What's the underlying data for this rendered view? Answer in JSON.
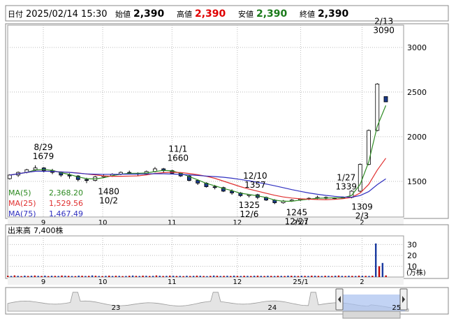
{
  "header": {
    "date_label": "日付",
    "date_value": "2025/02/14 15:30",
    "open_label": "始値",
    "open_value": "2,390",
    "high_label": "高値",
    "high_value": "2,390",
    "low_label": "安値",
    "low_value": "2,390",
    "close_label": "終値",
    "close_value": "2,390",
    "colors": {
      "high": "#e00000",
      "low": "#1a7a1a",
      "label": "#000000"
    }
  },
  "chart_data": [
    {
      "type": "candlestick",
      "y_ticks": [
        1500,
        2000,
        2500,
        3000
      ],
      "ylim": [
        1100,
        3250
      ],
      "x_ticks": [
        {
          "label": "9",
          "at": 0.09
        },
        {
          "label": "10",
          "at": 0.24
        },
        {
          "label": "11",
          "at": 0.415
        },
        {
          "label": "12",
          "at": 0.58
        },
        {
          "label": "25/1",
          "at": 0.74
        },
        {
          "label": "2",
          "at": 0.895
        }
      ],
      "moving_averages": [
        {
          "name": "MA(5)",
          "value": "2,368.20",
          "color": "#2e8b22"
        },
        {
          "name": "MA(25)",
          "value": "1,529.56",
          "color": "#e03030"
        },
        {
          "name": "MA(75)",
          "value": "1,467.49",
          "color": "#3030c0"
        }
      ],
      "annotations": [
        {
          "date": "8/29",
          "value": "1679",
          "at": 0.09,
          "pos": "above"
        },
        {
          "date": "10/2",
          "value": "1480",
          "at": 0.255,
          "pos": "below"
        },
        {
          "date": "11/1",
          "value": "1660",
          "at": 0.43,
          "pos": "above"
        },
        {
          "date": "12/10",
          "value": "1357",
          "at": 0.625,
          "pos": "above"
        },
        {
          "date": "12/6",
          "value": "1325",
          "at": 0.61,
          "pos": "below"
        },
        {
          "date": "12/27",
          "value": "1245",
          "at": 0.73,
          "pos": "below"
        },
        {
          "date": "1/27",
          "value": "1339",
          "at": 0.855,
          "pos": "above"
        },
        {
          "date": "2/3",
          "value": "1309",
          "at": 0.895,
          "pos": "below"
        },
        {
          "date": "2/13",
          "value": "3090",
          "at": 0.95,
          "pos": "above"
        }
      ],
      "price_series": [
        [
          1530,
          1580,
          1520,
          1570
        ],
        [
          1570,
          1610,
          1550,
          1600
        ],
        [
          1600,
          1640,
          1590,
          1630
        ],
        [
          1630,
          1679,
          1610,
          1650
        ],
        [
          1650,
          1660,
          1600,
          1620
        ],
        [
          1620,
          1640,
          1580,
          1600
        ],
        [
          1600,
          1610,
          1550,
          1570
        ],
        [
          1570,
          1590,
          1530,
          1560
        ],
        [
          1560,
          1570,
          1500,
          1520
        ],
        [
          1520,
          1540,
          1480,
          1510
        ],
        [
          1510,
          1560,
          1500,
          1550
        ],
        [
          1550,
          1580,
          1540,
          1560
        ],
        [
          1560,
          1590,
          1550,
          1580
        ],
        [
          1580,
          1610,
          1570,
          1600
        ],
        [
          1600,
          1620,
          1580,
          1590
        ],
        [
          1590,
          1600,
          1560,
          1580
        ],
        [
          1580,
          1620,
          1570,
          1610
        ],
        [
          1610,
          1660,
          1600,
          1640
        ],
        [
          1640,
          1650,
          1600,
          1620
        ],
        [
          1620,
          1630,
          1580,
          1590
        ],
        [
          1590,
          1600,
          1550,
          1560
        ],
        [
          1560,
          1570,
          1500,
          1510
        ],
        [
          1510,
          1520,
          1460,
          1480
        ],
        [
          1480,
          1490,
          1430,
          1440
        ],
        [
          1440,
          1460,
          1410,
          1430
        ],
        [
          1430,
          1440,
          1380,
          1390
        ],
        [
          1390,
          1410,
          1350,
          1370
        ],
        [
          1370,
          1380,
          1325,
          1340
        ],
        [
          1340,
          1357,
          1320,
          1350
        ],
        [
          1350,
          1360,
          1300,
          1320
        ],
        [
          1320,
          1330,
          1280,
          1290
        ],
        [
          1290,
          1300,
          1245,
          1260
        ],
        [
          1260,
          1290,
          1250,
          1280
        ],
        [
          1280,
          1300,
          1270,
          1290
        ],
        [
          1290,
          1310,
          1280,
          1300
        ],
        [
          1300,
          1320,
          1290,
          1310
        ],
        [
          1310,
          1339,
          1300,
          1320
        ],
        [
          1320,
          1330,
          1300,
          1310
        ],
        [
          1310,
          1320,
          1300,
          1315
        ],
        [
          1315,
          1330,
          1309,
          1320
        ],
        [
          1320,
          1400,
          1310,
          1390
        ],
        [
          1390,
          1700,
          1380,
          1690
        ],
        [
          1690,
          2080,
          1680,
          2070
        ],
        [
          2070,
          2600,
          2060,
          2590
        ],
        [
          2450,
          2450,
          2390,
          2390
        ]
      ]
    },
    {
      "type": "bar",
      "title": "出来高",
      "value_label": "7,400株",
      "unit": "(万株)",
      "y_ticks": [
        10,
        20,
        30
      ],
      "ylim": [
        0,
        38
      ],
      "values": [
        1.2,
        1.0,
        1.5,
        1.1,
        0.9,
        1.3,
        1.0,
        1.2,
        1.4,
        1.1,
        1.0,
        1.3,
        0.9,
        1.2,
        1.1,
        1.0,
        1.4,
        1.2,
        1.1,
        1.0,
        0.9,
        1.3,
        1.2,
        1.0,
        1.1,
        1.5,
        1.2,
        1.0,
        0.9,
        1.1,
        1.3,
        1.0,
        1.2,
        1.1,
        0.9,
        1.0,
        1.2,
        1.4,
        1.1,
        1.0,
        1.3,
        1.2,
        1.0,
        1.1,
        1.5,
        1.2,
        1.0,
        1.1,
        1.3,
        1.2,
        1.0,
        1.1,
        0.9,
        1.2,
        1.0,
        1.1,
        1.3,
        1.2,
        1.0,
        0.9,
        1.1,
        1.4,
        1.2,
        1.0,
        1.1,
        1.2,
        1.0,
        1.3,
        1.1,
        1.0,
        1.2,
        1.1,
        1.0,
        1.2,
        1.3,
        1.1,
        1.0,
        1.2,
        1.1,
        1.0,
        1.2,
        1.1,
        1.0,
        1.3,
        1.2,
        1.1,
        1.0,
        1.2,
        1.1,
        1.0,
        1.3,
        1.2,
        1.1,
        1.0,
        1.2,
        1.1,
        1.0,
        1.2,
        1.4,
        1.1,
        1.0,
        1.2,
        1.1,
        1.0,
        1.3,
        1.2,
        1.1,
        1.0,
        1.2,
        31,
        10,
        13,
        1.5
      ],
      "colors": [
        "#c00000",
        "#1a3aa0"
      ]
    },
    {
      "type": "area",
      "x_ticks": [
        {
          "label": "23",
          "at": 0.27
        },
        {
          "label": "24",
          "at": 0.66
        },
        {
          "label": "25",
          "at": 0.97
        }
      ]
    }
  ]
}
